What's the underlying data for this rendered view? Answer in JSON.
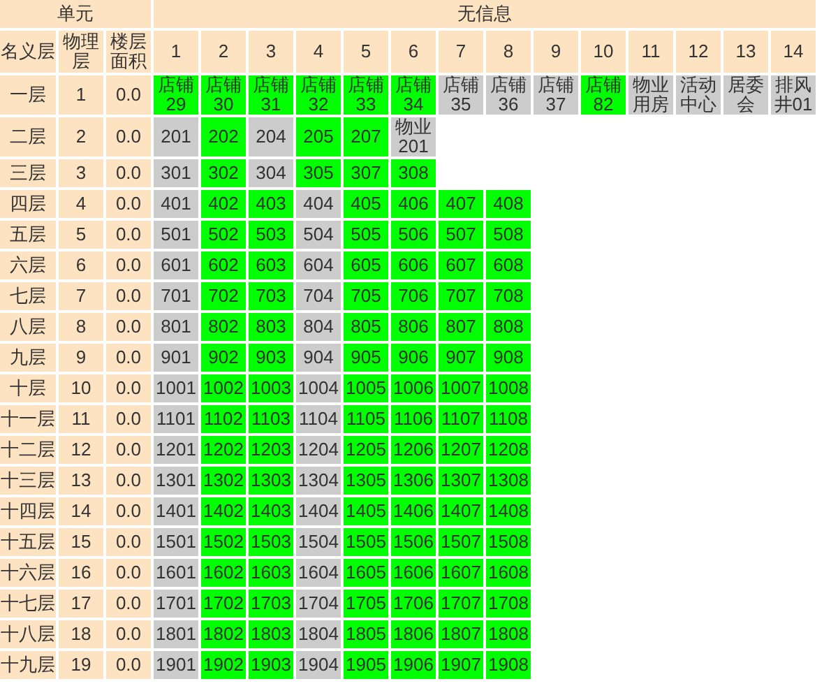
{
  "header": {
    "left": "单元",
    "right": "无信息"
  },
  "columns": [
    "名义层",
    "物理层",
    "楼层面积"
  ],
  "unit_numbers": [
    "1",
    "2",
    "3",
    "4",
    "5",
    "6",
    "7",
    "8",
    "9",
    "10",
    "11",
    "12",
    "13",
    "14"
  ],
  "floors": [
    {
      "name": "一层",
      "physical": "1",
      "area": "0.0",
      "units": [
        {
          "label": "店铺29",
          "color": "#00ff00"
        },
        {
          "label": "店铺30",
          "color": "#00ff00"
        },
        {
          "label": "店铺31",
          "color": "#00ff00"
        },
        {
          "label": "店铺32",
          "color": "#00ff00"
        },
        {
          "label": "店铺33",
          "color": "#00ff00"
        },
        {
          "label": "店铺34",
          "color": "#00ff00"
        },
        {
          "label": "店铺35",
          "color": "#cccccc"
        },
        {
          "label": "店铺36",
          "color": "#cccccc"
        },
        {
          "label": "店铺37",
          "color": "#cccccc"
        },
        {
          "label": "店铺82",
          "color": "#00ff00"
        },
        {
          "label": "物业用房",
          "color": "#cccccc"
        },
        {
          "label": "活动中心",
          "color": "#cccccc"
        },
        {
          "label": "居委会",
          "color": "#cccccc"
        },
        {
          "label": "排风井01",
          "color": "#cccccc"
        }
      ]
    },
    {
      "name": "二层",
      "physical": "2",
      "area": "0.0",
      "units": [
        {
          "label": "201",
          "color": "#cccccc"
        },
        {
          "label": "202",
          "color": "#00ff00"
        },
        {
          "label": "204",
          "color": "#cccccc"
        },
        {
          "label": "205",
          "color": "#00ff00"
        },
        {
          "label": "207",
          "color": "#00ff00"
        },
        {
          "label": "物业201",
          "color": "#cccccc"
        }
      ]
    },
    {
      "name": "三层",
      "physical": "3",
      "area": "0.0",
      "units": [
        {
          "label": "301",
          "color": "#cccccc"
        },
        {
          "label": "302",
          "color": "#00ff00"
        },
        {
          "label": "304",
          "color": "#cccccc"
        },
        {
          "label": "305",
          "color": "#00ff00"
        },
        {
          "label": "307",
          "color": "#00ff00"
        },
        {
          "label": "308",
          "color": "#00ff00"
        }
      ]
    },
    {
      "name": "四层",
      "physical": "4",
      "area": "0.0",
      "units": [
        {
          "label": "401",
          "color": "#cccccc"
        },
        {
          "label": "402",
          "color": "#00ff00"
        },
        {
          "label": "403",
          "color": "#00ff00"
        },
        {
          "label": "404",
          "color": "#cccccc"
        },
        {
          "label": "405",
          "color": "#00ff00"
        },
        {
          "label": "406",
          "color": "#00ff00"
        },
        {
          "label": "407",
          "color": "#00ff00"
        },
        {
          "label": "408",
          "color": "#00ff00"
        }
      ]
    },
    {
      "name": "五层",
      "physical": "5",
      "area": "0.0",
      "units": [
        {
          "label": "501",
          "color": "#cccccc"
        },
        {
          "label": "502",
          "color": "#00ff00"
        },
        {
          "label": "503",
          "color": "#00ff00"
        },
        {
          "label": "504",
          "color": "#cccccc"
        },
        {
          "label": "505",
          "color": "#00ff00"
        },
        {
          "label": "506",
          "color": "#00ff00"
        },
        {
          "label": "507",
          "color": "#00ff00"
        },
        {
          "label": "508",
          "color": "#00ff00"
        }
      ]
    },
    {
      "name": "六层",
      "physical": "6",
      "area": "0.0",
      "units": [
        {
          "label": "601",
          "color": "#cccccc"
        },
        {
          "label": "602",
          "color": "#00ff00"
        },
        {
          "label": "603",
          "color": "#00ff00"
        },
        {
          "label": "604",
          "color": "#cccccc"
        },
        {
          "label": "605",
          "color": "#00ff00"
        },
        {
          "label": "606",
          "color": "#00ff00"
        },
        {
          "label": "607",
          "color": "#00ff00"
        },
        {
          "label": "608",
          "color": "#00ff00"
        }
      ]
    },
    {
      "name": "七层",
      "physical": "7",
      "area": "0.0",
      "units": [
        {
          "label": "701",
          "color": "#cccccc"
        },
        {
          "label": "702",
          "color": "#00ff00"
        },
        {
          "label": "703",
          "color": "#00ff00"
        },
        {
          "label": "704",
          "color": "#cccccc"
        },
        {
          "label": "705",
          "color": "#00ff00"
        },
        {
          "label": "706",
          "color": "#00ff00"
        },
        {
          "label": "707",
          "color": "#00ff00"
        },
        {
          "label": "708",
          "color": "#00ff00"
        }
      ]
    },
    {
      "name": "八层",
      "physical": "8",
      "area": "0.0",
      "units": [
        {
          "label": "801",
          "color": "#cccccc"
        },
        {
          "label": "802",
          "color": "#00ff00"
        },
        {
          "label": "803",
          "color": "#00ff00"
        },
        {
          "label": "804",
          "color": "#cccccc"
        },
        {
          "label": "805",
          "color": "#00ff00"
        },
        {
          "label": "806",
          "color": "#00ff00"
        },
        {
          "label": "807",
          "color": "#00ff00"
        },
        {
          "label": "808",
          "color": "#00ff00"
        }
      ]
    },
    {
      "name": "九层",
      "physical": "9",
      "area": "0.0",
      "units": [
        {
          "label": "901",
          "color": "#cccccc"
        },
        {
          "label": "902",
          "color": "#00ff00"
        },
        {
          "label": "903",
          "color": "#00ff00"
        },
        {
          "label": "904",
          "color": "#cccccc"
        },
        {
          "label": "905",
          "color": "#00ff00"
        },
        {
          "label": "906",
          "color": "#00ff00"
        },
        {
          "label": "907",
          "color": "#00ff00"
        },
        {
          "label": "908",
          "color": "#00ff00"
        }
      ]
    },
    {
      "name": "十层",
      "physical": "10",
      "area": "0.0",
      "units": [
        {
          "label": "1001",
          "color": "#cccccc"
        },
        {
          "label": "1002",
          "color": "#00ff00"
        },
        {
          "label": "1003",
          "color": "#00ff00"
        },
        {
          "label": "1004",
          "color": "#cccccc"
        },
        {
          "label": "1005",
          "color": "#00ff00"
        },
        {
          "label": "1006",
          "color": "#00ff00"
        },
        {
          "label": "1007",
          "color": "#00ff00"
        },
        {
          "label": "1008",
          "color": "#00ff00"
        }
      ]
    },
    {
      "name": "十一层",
      "physical": "11",
      "area": "0.0",
      "units": [
        {
          "label": "1101",
          "color": "#cccccc"
        },
        {
          "label": "1102",
          "color": "#00ff00"
        },
        {
          "label": "1103",
          "color": "#00ff00"
        },
        {
          "label": "1104",
          "color": "#cccccc"
        },
        {
          "label": "1105",
          "color": "#00ff00"
        },
        {
          "label": "1106",
          "color": "#00ff00"
        },
        {
          "label": "1107",
          "color": "#00ff00"
        },
        {
          "label": "1108",
          "color": "#00ff00"
        }
      ]
    },
    {
      "name": "十二层",
      "physical": "12",
      "area": "0.0",
      "units": [
        {
          "label": "1201",
          "color": "#cccccc"
        },
        {
          "label": "1202",
          "color": "#00ff00"
        },
        {
          "label": "1203",
          "color": "#00ff00"
        },
        {
          "label": "1204",
          "color": "#cccccc"
        },
        {
          "label": "1205",
          "color": "#00ff00"
        },
        {
          "label": "1206",
          "color": "#00ff00"
        },
        {
          "label": "1207",
          "color": "#00ff00"
        },
        {
          "label": "1208",
          "color": "#00ff00"
        }
      ]
    },
    {
      "name": "十三层",
      "physical": "13",
      "area": "0.0",
      "units": [
        {
          "label": "1301",
          "color": "#cccccc"
        },
        {
          "label": "1302",
          "color": "#00ff00"
        },
        {
          "label": "1303",
          "color": "#00ff00"
        },
        {
          "label": "1304",
          "color": "#cccccc"
        },
        {
          "label": "1305",
          "color": "#00ff00"
        },
        {
          "label": "1306",
          "color": "#00ff00"
        },
        {
          "label": "1307",
          "color": "#00ff00"
        },
        {
          "label": "1308",
          "color": "#00ff00"
        }
      ]
    },
    {
      "name": "十四层",
      "physical": "14",
      "area": "0.0",
      "units": [
        {
          "label": "1401",
          "color": "#cccccc"
        },
        {
          "label": "1402",
          "color": "#00ff00"
        },
        {
          "label": "1403",
          "color": "#00ff00"
        },
        {
          "label": "1404",
          "color": "#cccccc"
        },
        {
          "label": "1405",
          "color": "#00ff00"
        },
        {
          "label": "1406",
          "color": "#00ff00"
        },
        {
          "label": "1407",
          "color": "#00ff00"
        },
        {
          "label": "1408",
          "color": "#00ff00"
        }
      ]
    },
    {
      "name": "十五层",
      "physical": "15",
      "area": "0.0",
      "units": [
        {
          "label": "1501",
          "color": "#cccccc"
        },
        {
          "label": "1502",
          "color": "#00ff00"
        },
        {
          "label": "1503",
          "color": "#00ff00"
        },
        {
          "label": "1504",
          "color": "#cccccc"
        },
        {
          "label": "1505",
          "color": "#00ff00"
        },
        {
          "label": "1506",
          "color": "#00ff00"
        },
        {
          "label": "1507",
          "color": "#00ff00"
        },
        {
          "label": "1508",
          "color": "#00ff00"
        }
      ]
    },
    {
      "name": "十六层",
      "physical": "16",
      "area": "0.0",
      "units": [
        {
          "label": "1601",
          "color": "#cccccc"
        },
        {
          "label": "1602",
          "color": "#00ff00"
        },
        {
          "label": "1603",
          "color": "#00ff00"
        },
        {
          "label": "1604",
          "color": "#cccccc"
        },
        {
          "label": "1605",
          "color": "#00ff00"
        },
        {
          "label": "1606",
          "color": "#00ff00"
        },
        {
          "label": "1607",
          "color": "#00ff00"
        },
        {
          "label": "1608",
          "color": "#00ff00"
        }
      ]
    },
    {
      "name": "十七层",
      "physical": "17",
      "area": "0.0",
      "units": [
        {
          "label": "1701",
          "color": "#cccccc"
        },
        {
          "label": "1702",
          "color": "#00ff00"
        },
        {
          "label": "1703",
          "color": "#00ff00"
        },
        {
          "label": "1704",
          "color": "#cccccc"
        },
        {
          "label": "1705",
          "color": "#00ff00"
        },
        {
          "label": "1706",
          "color": "#00ff00"
        },
        {
          "label": "1707",
          "color": "#00ff00"
        },
        {
          "label": "1708",
          "color": "#00ff00"
        }
      ]
    },
    {
      "name": "十八层",
      "physical": "18",
      "area": "0.0",
      "units": [
        {
          "label": "1801",
          "color": "#cccccc"
        },
        {
          "label": "1802",
          "color": "#00ff00"
        },
        {
          "label": "1803",
          "color": "#00ff00"
        },
        {
          "label": "1804",
          "color": "#cccccc"
        },
        {
          "label": "1805",
          "color": "#00ff00"
        },
        {
          "label": "1806",
          "color": "#00ff00"
        },
        {
          "label": "1807",
          "color": "#00ff00"
        },
        {
          "label": "1808",
          "color": "#00ff00"
        }
      ]
    },
    {
      "name": "十九层",
      "physical": "19",
      "area": "0.0",
      "units": [
        {
          "label": "1901",
          "color": "#cccccc"
        },
        {
          "label": "1902",
          "color": "#00ff00"
        },
        {
          "label": "1903",
          "color": "#00ff00"
        },
        {
          "label": "1904",
          "color": "#cccccc"
        },
        {
          "label": "1905",
          "color": "#00ff00"
        },
        {
          "label": "1906",
          "color": "#00ff00"
        },
        {
          "label": "1907",
          "color": "#00ff00"
        },
        {
          "label": "1908",
          "color": "#00ff00"
        }
      ]
    }
  ]
}
